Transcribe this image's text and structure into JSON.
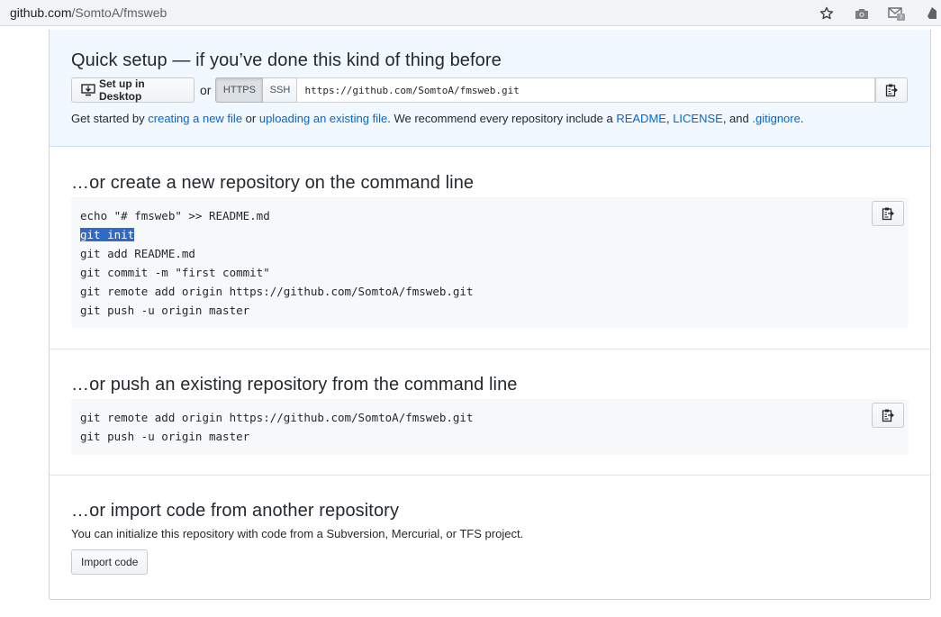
{
  "browser": {
    "url_host": "github.com",
    "url_path": "/SomtoA/fmsweb",
    "icons": [
      "star-icon",
      "camera-icon",
      "gmail-icon",
      "extension-icon"
    ]
  },
  "quick_setup": {
    "title": "Quick setup — if you’ve done this kind of thing before",
    "desktop_button": "Set up in Desktop",
    "or_text": "or",
    "protocols": [
      "HTTPS",
      "SSH"
    ],
    "selected_protocol": "HTTPS",
    "clone_url": "https://github.com/SomtoA/fmsweb.git",
    "get_started": {
      "prefix": "Get started by ",
      "link1": "creating a new file",
      "mid1": " or ",
      "link2": "uploading an existing file",
      "mid2": ". We recommend every repository include a ",
      "link3": "README",
      "sep1": ", ",
      "link4": "LICENSE",
      "mid3": ", and ",
      "link5": ".gitignore",
      "suffix": "."
    }
  },
  "new_repo": {
    "title": "…or create a new repository on the command line",
    "lines": [
      "echo \"# fmsweb\" >> README.md",
      "git init",
      "git add README.md",
      "git commit -m \"first commit\"",
      "git remote add origin https://github.com/SomtoA/fmsweb.git",
      "git push -u origin master"
    ],
    "highlighted_line": "git init"
  },
  "push_repo": {
    "title": "…or push an existing repository from the command line",
    "lines": [
      "git remote add origin https://github.com/SomtoA/fmsweb.git",
      "git push -u origin master"
    ]
  },
  "import_repo": {
    "title": "…or import code from another repository",
    "description": "You can initialize this repository with code from a Subversion, Mercurial, or TFS project.",
    "button": "Import code"
  }
}
